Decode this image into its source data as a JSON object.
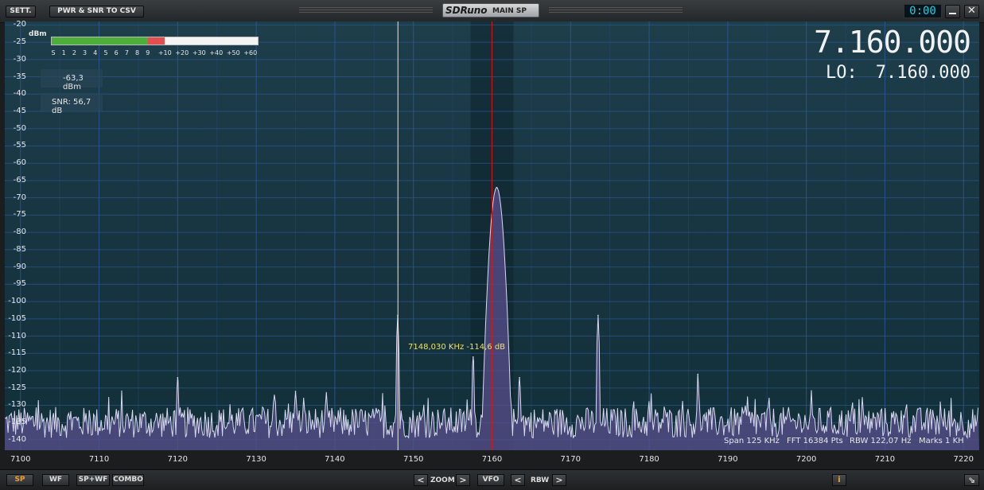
{
  "header": {
    "sett_label": "SETT.",
    "csv_label": "PWR & SNR TO CSV",
    "app_logo": "SDRuno",
    "panel_title": "MAIN SP",
    "clock": "0:00",
    "minimize_icon": "minimize-icon",
    "close_icon": "close-icon"
  },
  "readout": {
    "frequency": "7.160.000",
    "lo_label": "LO:",
    "lo_value": "7.160.000"
  },
  "smeter": {
    "unit": "dBm",
    "scale": [
      "S",
      "1",
      "2",
      "3",
      "4",
      "5",
      "6",
      "7",
      "8",
      "9",
      "+10",
      "+20",
      "+30",
      "+40",
      "+50",
      "+60"
    ],
    "level_fraction": 0.55,
    "green_color": "#4caf3a",
    "red_color": "#e05050"
  },
  "measurements": {
    "power": "-63,3 dBm",
    "snr": "SNR: 56,7 dB"
  },
  "cursor_label": "7148,030 KHz -114,6 dB",
  "status": {
    "span": "Span 125 KHz",
    "fft": "FFT 16384 Pts",
    "rbw": "RBW 122,07 Hz",
    "marks": "Marks 1 KH"
  },
  "chart_data": {
    "type": "line",
    "xlabel": "",
    "ylabel": "",
    "x_unit": "KHz",
    "xlim": [
      7098,
      7222
    ],
    "ylim": [
      -143,
      -19
    ],
    "x_ticks": [
      7100,
      7110,
      7120,
      7130,
      7140,
      7150,
      7160,
      7170,
      7180,
      7190,
      7200,
      7210,
      7220
    ],
    "y_ticks": [
      -20,
      -25,
      -30,
      -35,
      -40,
      -45,
      -50,
      -55,
      -60,
      -65,
      -70,
      -75,
      -80,
      -85,
      -90,
      -95,
      -100,
      -105,
      -110,
      -115,
      -120,
      -125,
      -130,
      -135,
      -140
    ],
    "noise_floor_db": -135,
    "peaks": [
      {
        "x": 7120.0,
        "y": -122
      },
      {
        "x": 7135.0,
        "y": -126
      },
      {
        "x": 7148.0,
        "y": -104
      },
      {
        "x": 7157.6,
        "y": -116
      },
      {
        "x": 7160.6,
        "y": -67
      },
      {
        "x": 7163.5,
        "y": -122
      },
      {
        "x": 7173.5,
        "y": -104
      },
      {
        "x": 7186.2,
        "y": -121
      }
    ],
    "vfo_marker_khz": 7160.0,
    "cursor_marker_khz": 7148.03,
    "line_color": "#d8d8f0",
    "fill_color": "#5a4f8e",
    "vfo_color": "#d01818",
    "grid": true
  },
  "footer": {
    "sp": "SP",
    "wf": "WF",
    "spwf": "SP+WF",
    "combo": "COMBO",
    "zoom_prev": "<",
    "zoom_label": "ZOOM",
    "zoom_next": ">",
    "vfo": "VFO",
    "rbw_prev": "<",
    "rbw_label": "RBW",
    "rbw_next": ">",
    "info": "i",
    "resize_icon": "resize-icon"
  }
}
